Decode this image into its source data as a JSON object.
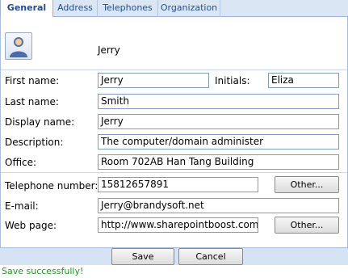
{
  "tabs": [
    "General",
    "Address",
    "Telephones",
    "Organization"
  ],
  "header": {
    "display_name": "Jerry"
  },
  "fields": {
    "first_name_label": "First name:",
    "first_name": "Jerry",
    "initials_label": "Initials:",
    "initials": "Eliza",
    "last_name_label": "Last name:",
    "last_name": "Smith",
    "display_name_label": "Display name:",
    "display_name": "Jerry",
    "description_label": "Description:",
    "description": "The computer/domain administer",
    "office_label": "Office:",
    "office": "Room 702AB Han Tang Building",
    "telephone_label": "Telephone number:",
    "telephone": "15812657891",
    "email_label": "E-mail:",
    "email": "Jerry@brandysoft.net",
    "web_label": "Web page:",
    "web": "http://www.sharepointboost.com"
  },
  "buttons": {
    "other_phone": "Other...",
    "other_web": "Other...",
    "save": "Save",
    "cancel": "Cancel"
  },
  "status": "Save successfully!",
  "icons": {
    "avatar": "user-avatar-icon"
  }
}
